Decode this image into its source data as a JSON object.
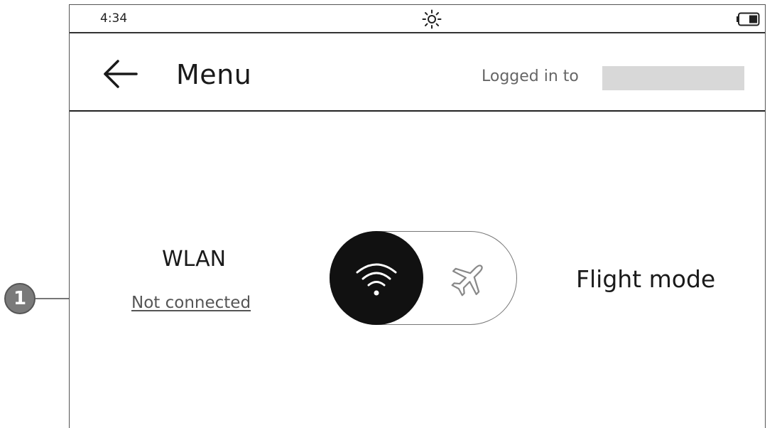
{
  "status_bar": {
    "time": "4:34",
    "brightness_icon": "brightness-icon",
    "battery_icon": "battery-icon"
  },
  "header": {
    "back_icon": "arrow-left-icon",
    "title": "Menu",
    "login_label": "Logged in to"
  },
  "connectivity": {
    "wlan_label": "WLAN",
    "wlan_status": "Not connected",
    "flight_mode_label": "Flight mode",
    "toggle_state": "WLAN",
    "wlan_icon": "wifi-icon",
    "flight_icon": "airplane-icon"
  },
  "annotation": {
    "callout_number": "1"
  },
  "colors": {
    "knob": "#111111",
    "account_redaction": "#d8d8d8",
    "callout": "#7a7a7a"
  }
}
